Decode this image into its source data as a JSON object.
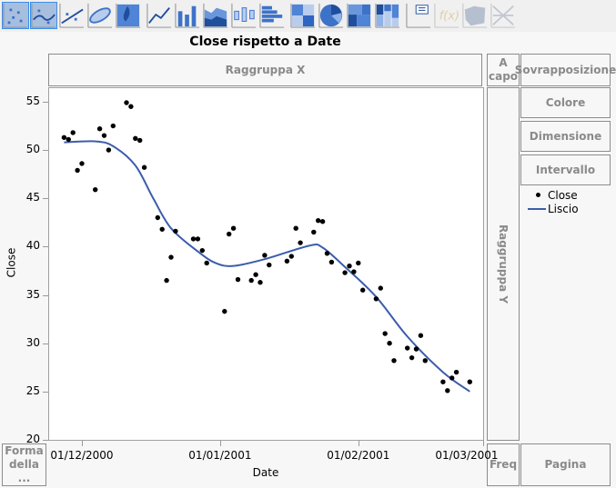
{
  "toolbar": {
    "icons": [
      "points-icon",
      "smoother-icon",
      "line-of-fit-icon",
      "ellipse-icon",
      "contour-icon",
      "line-chart-icon",
      "bar-chart-icon",
      "area-chart-icon",
      "box-plot-icon",
      "histogram-icon",
      "heatmap-icon",
      "pie-chart-icon",
      "treemap-icon",
      "mosaic-icon",
      "caption-box-icon",
      "formula-icon",
      "map-shapes-icon",
      "parallel-icon"
    ],
    "selected": [
      "points-icon",
      "smoother-icon"
    ],
    "disabled": [
      "formula-icon",
      "map-shapes-icon",
      "parallel-icon"
    ]
  },
  "title": "Close rispetto a Date",
  "zones": {
    "group_x": "Raggruppa X",
    "wrap": "A capo",
    "overlay": "Sovrapposizione",
    "color": "Colore",
    "size": "Dimensione",
    "interval": "Intervallo",
    "group_y": "Raggruppa Y",
    "shape": "Forma della ...",
    "freq": "Freq",
    "page": "Pagina"
  },
  "legend": {
    "points": "Close",
    "smoother": "Liscio"
  },
  "colors": {
    "points": "#000000",
    "smoother": "#3b5dab",
    "accent": "#3d8ee6"
  },
  "chart_data": {
    "type": "scatter",
    "title": "Close rispetto a Date",
    "xlabel": "Date",
    "ylabel": "Close",
    "xlim": [
      "2000-11-26",
      "2001-03-01"
    ],
    "ylim": [
      20,
      56.5
    ],
    "xticks": [
      "01/12/2000",
      "01/01/2001",
      "01/02/2001",
      "01/03/2001"
    ],
    "yticks": [
      20,
      25,
      30,
      35,
      40,
      45,
      50,
      55
    ],
    "grid": false,
    "legend": "right",
    "points": [
      [
        "2000-11-27",
        51.3
      ],
      [
        "2000-11-28",
        51.1
      ],
      [
        "2000-11-29",
        51.8
      ],
      [
        "2000-11-30",
        47.9
      ],
      [
        "2000-12-01",
        48.6
      ],
      [
        "2000-12-04",
        45.9
      ],
      [
        "2000-12-05",
        52.2
      ],
      [
        "2000-12-06",
        51.5
      ],
      [
        "2000-12-07",
        50.0
      ],
      [
        "2000-12-08",
        52.5
      ],
      [
        "2000-12-11",
        54.9
      ],
      [
        "2000-12-12",
        54.5
      ],
      [
        "2000-12-13",
        51.2
      ],
      [
        "2000-12-14",
        51.0
      ],
      [
        "2000-12-15",
        48.2
      ],
      [
        "2000-12-18",
        43.0
      ],
      [
        "2000-12-19",
        41.8
      ],
      [
        "2000-12-20",
        36.5
      ],
      [
        "2000-12-21",
        38.9
      ],
      [
        "2000-12-22",
        41.6
      ],
      [
        "2000-12-26",
        40.8
      ],
      [
        "2000-12-27",
        40.8
      ],
      [
        "2000-12-28",
        39.6
      ],
      [
        "2000-12-29",
        38.3
      ],
      [
        "2001-01-02",
        33.3
      ],
      [
        "2001-01-03",
        41.3
      ],
      [
        "2001-01-04",
        41.9
      ],
      [
        "2001-01-05",
        36.6
      ],
      [
        "2001-01-08",
        36.5
      ],
      [
        "2001-01-09",
        37.1
      ],
      [
        "2001-01-10",
        36.3
      ],
      [
        "2001-01-11",
        39.1
      ],
      [
        "2001-01-12",
        38.1
      ],
      [
        "2001-01-16",
        38.5
      ],
      [
        "2001-01-17",
        39.0
      ],
      [
        "2001-01-18",
        41.9
      ],
      [
        "2001-01-19",
        40.4
      ],
      [
        "2001-01-22",
        41.5
      ],
      [
        "2001-01-23",
        42.7
      ],
      [
        "2001-01-24",
        42.6
      ],
      [
        "2001-01-25",
        39.3
      ],
      [
        "2001-01-26",
        38.4
      ],
      [
        "2001-01-29",
        37.3
      ],
      [
        "2001-01-30",
        38.0
      ],
      [
        "2001-01-31",
        37.4
      ],
      [
        "2001-02-01",
        38.3
      ],
      [
        "2001-02-02",
        35.5
      ],
      [
        "2001-02-05",
        34.6
      ],
      [
        "2001-02-06",
        35.7
      ],
      [
        "2001-02-07",
        31.0
      ],
      [
        "2001-02-08",
        30.0
      ],
      [
        "2001-02-09",
        28.2
      ],
      [
        "2001-02-12",
        29.5
      ],
      [
        "2001-02-13",
        28.5
      ],
      [
        "2001-02-14",
        29.4
      ],
      [
        "2001-02-15",
        30.8
      ],
      [
        "2001-02-16",
        28.2
      ],
      [
        "2001-02-20",
        26.0
      ],
      [
        "2001-02-21",
        25.1
      ],
      [
        "2001-02-22",
        26.4
      ],
      [
        "2001-02-23",
        27.0
      ],
      [
        "2001-02-26",
        26.0
      ]
    ],
    "smoother": [
      [
        "2000-11-27",
        50.8
      ],
      [
        "2000-12-04",
        50.9
      ],
      [
        "2000-12-08",
        50.4
      ],
      [
        "2000-12-13",
        48.4
      ],
      [
        "2000-12-17",
        45.0
      ],
      [
        "2000-12-21",
        41.9
      ],
      [
        "2000-12-27",
        39.5
      ],
      [
        "2000-12-31",
        38.3
      ],
      [
        "2001-01-04",
        38.0
      ],
      [
        "2001-01-11",
        38.7
      ],
      [
        "2001-01-21",
        40.1
      ],
      [
        "2001-01-24",
        39.9
      ],
      [
        "2001-01-29",
        37.9
      ],
      [
        "2001-02-05",
        34.8
      ],
      [
        "2001-02-12",
        30.7
      ],
      [
        "2001-02-20",
        27.0
      ],
      [
        "2001-02-26",
        25.0
      ]
    ]
  }
}
